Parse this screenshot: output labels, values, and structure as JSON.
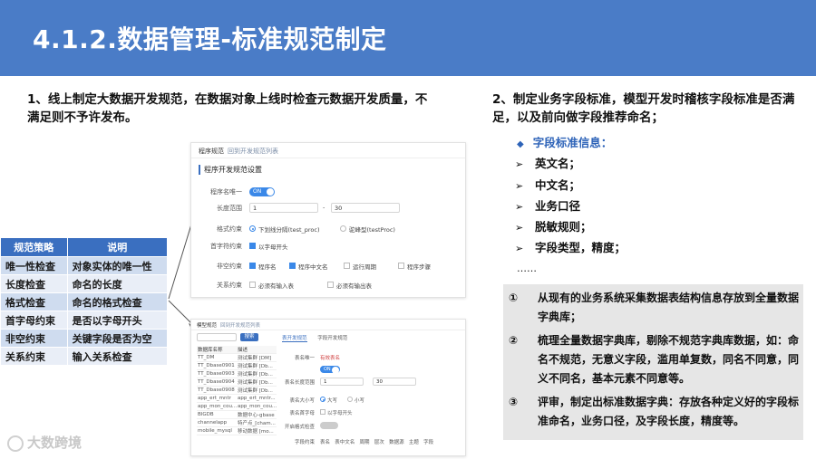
{
  "title": "4.1.2.数据管理-标准规范制定",
  "lead_left": "1、线上制定大数据开发规范，在数据对象上线时检查元数据开发质量，不满足则不予许发布。",
  "lead_right": "2、制定业务字段标准，模型开发时稽核字段标准是否满足，以及前向做字段推荐命名；",
  "strategy_table": {
    "headers": [
      "规范策略",
      "说明"
    ],
    "rows": [
      [
        "唯一性检查",
        "对象实体的唯一性"
      ],
      [
        "长度检查",
        "命名的长度"
      ],
      [
        "格式检查",
        "命名的格式检查"
      ],
      [
        "首字母约束",
        "是否以字母开头"
      ],
      [
        "非空约束",
        "关键字段是否为空"
      ],
      [
        "关系约束",
        "输入关系检查"
      ]
    ]
  },
  "shot1": {
    "breadcrumb": "程序规范",
    "back": "回到开发规范列表",
    "section": "程序开发规范设置",
    "unique_label": "程序名唯一",
    "unique_toggle": "ON",
    "length_label": "长度范围",
    "length_min": "1",
    "length_max": "30",
    "format_label": "格式约束",
    "format_opt1": "下划线分隔(test_proc)",
    "format_opt2": "驼峰型(testProc)",
    "first_label": "首字符约束",
    "first_opt": "以字母开头",
    "notnull_label": "非空约束",
    "notnull_opts": [
      "程序名",
      "程序中文名",
      "运行周期",
      "程序步骤"
    ],
    "rel_label": "关系约束",
    "rel_opts": [
      "必须有输入表",
      "必须有输出表"
    ]
  },
  "shot2": {
    "breadcrumb": "模型规范",
    "back": "回到开发规范列表",
    "search_btn": "搜索",
    "list_headers": [
      "数据库名称",
      "描述"
    ],
    "list_rows": [
      [
        "TT_DM",
        "测试集群 [DM]"
      ],
      [
        "TT_Dbase0901",
        "测试集群 [Db..."
      ],
      [
        "TT_Dbase0903",
        "测试集群 [Db..."
      ],
      [
        "TT_Dbase0904",
        "测试集群 [Db..."
      ],
      [
        "TT_Dbase0908",
        "测试集群 [Db..."
      ],
      [
        "app_ert_mntr",
        "app_ert_mntr..."
      ],
      [
        "app_mon_cou...",
        "app_mon_cou..."
      ],
      [
        "BIGDB",
        "数据中心-gbase"
      ],
      [
        "channelapp",
        "特产点_[cham..."
      ],
      [
        "mobile_mysql",
        "移动数据 [mo..."
      ]
    ],
    "tabs": [
      "表开发规范",
      "字段开发规范"
    ],
    "unique_label": "表名唯一",
    "unique_value": "有效表名",
    "toggle": "ON",
    "len_label": "表名长度范围",
    "len_min": "1",
    "len_max": "30",
    "case_label": "表名大小写",
    "case_opts": [
      "大写",
      "小写"
    ],
    "first_label": "表名首字母",
    "first_opt": "以字母开头",
    "notnull_label": "开启格式检查",
    "field_label": "字段约束",
    "field_opts": [
      "表名",
      "表中文名",
      "周期",
      "层次",
      "数据源",
      "主题",
      "字段"
    ]
  },
  "bullet_head": "字段标准信息：",
  "bullets": [
    "英文名；",
    "中文名；",
    "业务口径",
    "脱敏规则；",
    "字段类型，精度；"
  ],
  "ellipsis": "……",
  "info_items": [
    {
      "num": "①",
      "text": "从现有的业务系统采集数据表结构信息存放到全量数据字典库；"
    },
    {
      "num": "②",
      "text": "梳理全量数据字典库，剔除不规范字典库数据，如：命名不规范，无意义字段，滥用单复数，同名不同意，同义不同名，基本元素不同意等。"
    },
    {
      "num": "③",
      "text": "评审，制定出标准数据字典：存放各种定义好的字段标准命名，业务口径，及字段长度，精度等。"
    }
  ],
  "logo_text": "大数跨境"
}
